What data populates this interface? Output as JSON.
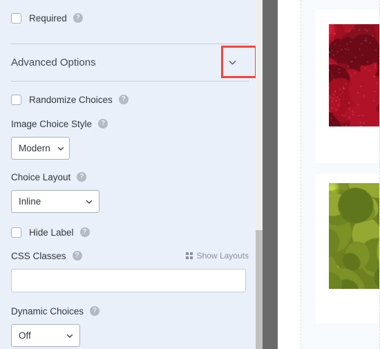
{
  "panel": {
    "required": {
      "label": "Required",
      "checked": false,
      "help_icon": "help-circle-icon"
    },
    "advanced_options": {
      "title": "Advanced Options",
      "toggle_icon": "chevron-down-icon",
      "expanded": true,
      "highlight_color": "#f9423a"
    },
    "randomize_choices": {
      "label": "Randomize Choices",
      "checked": false,
      "help_icon": "help-circle-icon"
    },
    "image_choice_style": {
      "label": "Image Choice Style",
      "help_icon": "help-circle-icon",
      "value": "Modern",
      "options": [
        "Modern"
      ],
      "chevron_icon": "chevron-down-icon"
    },
    "choice_layout": {
      "label": "Choice Layout",
      "help_icon": "help-circle-icon",
      "value": "Inline",
      "options": [
        "Inline"
      ],
      "chevron_icon": "chevron-down-icon"
    },
    "hide_label": {
      "label": "Hide Label",
      "checked": false,
      "help_icon": "help-circle-icon"
    },
    "css_classes": {
      "label": "CSS Classes",
      "help_icon": "help-circle-icon",
      "value": "",
      "placeholder": "",
      "show_layouts_label": "Show Layouts",
      "show_layouts_icon": "grid-icon"
    },
    "dynamic_choices": {
      "label": "Dynamic Choices",
      "help_icon": "help-circle-icon",
      "value": "Off",
      "options": [
        "Off"
      ],
      "chevron_icon": "chevron-down-icon"
    },
    "background_color": "#e9f0fa"
  },
  "scrollbars": {
    "inner": {
      "name": "panel-scrollbar",
      "track_color": "#f0efef",
      "thumb_color": "#c1c1c1"
    },
    "outer": {
      "name": "window-scrollbar",
      "color": "#6a6a6a"
    }
  },
  "preview": {
    "background_color": "#f7fafd",
    "cards": [
      {
        "name": "image-choice-card-strawberries",
        "photo": "strawberries-photo"
      },
      {
        "name": "image-choice-card-pears",
        "photo": "pears-photo"
      }
    ]
  },
  "icons": {
    "help": "?",
    "chevron_down": "chevron-down-icon"
  }
}
